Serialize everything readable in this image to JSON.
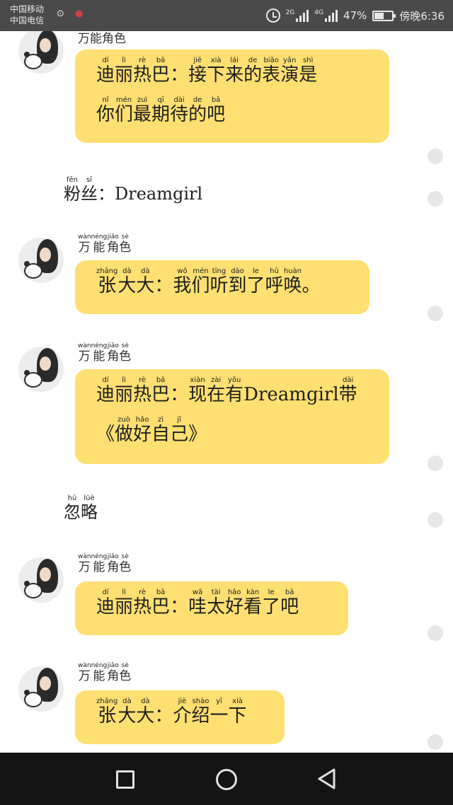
{
  "status_bar": {
    "carrier_1": "中国移动",
    "carrier_2": "中国电信",
    "network_1": "2G",
    "network_2": "4G",
    "battery": "47%",
    "battery_level": 0.47,
    "time": "傍晚6:36",
    "icons": [
      "alarm-icon",
      "signal-icon",
      "battery-icon"
    ]
  },
  "chat": {
    "messages": [
      {
        "sender": "万能角色",
        "pinyin_shown": false,
        "lines": [
          [
            [
              "迪",
              "dí"
            ],
            [
              "丽",
              "lì"
            ],
            [
              "热",
              "rè"
            ],
            [
              "巴",
              "bā"
            ],
            [
              "：",
              ""
            ],
            [
              "接",
              "jiē"
            ],
            [
              "下",
              "xià"
            ],
            [
              "来",
              "lái"
            ],
            [
              "的",
              "de"
            ],
            [
              "表",
              "biǎo"
            ],
            [
              "演",
              "yǎn"
            ],
            [
              "是",
              "shì"
            ]
          ],
          [
            [
              "你",
              "nǐ"
            ],
            [
              "们",
              "mén"
            ],
            [
              "最",
              "zuì"
            ],
            [
              "期",
              "qī"
            ],
            [
              "待",
              "dài"
            ],
            [
              "的",
              "de"
            ],
            [
              "吧",
              "bā"
            ]
          ]
        ]
      },
      {
        "plain": true,
        "lines": [
          [
            [
              "粉",
              "fěn"
            ],
            [
              "丝",
              "sī"
            ],
            [
              "：",
              ""
            ],
            [
              "Dreamgirl",
              ""
            ]
          ]
        ]
      },
      {
        "sender": "万能角色",
        "pinyin_shown": true,
        "sender_pinyin": [
          "wàn",
          "néng",
          "jiǎo",
          "sè"
        ],
        "lines": [
          [
            [
              "张",
              "zhāng"
            ],
            [
              "大",
              "dà"
            ],
            [
              "大",
              "dà"
            ],
            [
              "：",
              ""
            ],
            [
              "我",
              "wǒ"
            ],
            [
              "们",
              "mén"
            ],
            [
              "听",
              "tīng"
            ],
            [
              "到",
              "dào"
            ],
            [
              "了",
              "le"
            ],
            [
              "呼",
              "hū"
            ],
            [
              "唤",
              "huàn"
            ],
            [
              "。",
              ""
            ]
          ]
        ]
      },
      {
        "sender": "万能角色",
        "pinyin_shown": true,
        "sender_pinyin": [
          "wàn",
          "néng",
          "jiǎo",
          "sè"
        ],
        "lines": [
          [
            [
              "迪",
              "dí"
            ],
            [
              "丽",
              "lì"
            ],
            [
              "热",
              "rè"
            ],
            [
              "巴",
              "bā"
            ],
            [
              "：",
              ""
            ],
            [
              "现",
              "xiàn"
            ],
            [
              "在",
              "zài"
            ],
            [
              "有",
              "yǒu"
            ],
            [
              "Dreamgirl",
              ""
            ],
            [
              "带",
              "dài"
            ]
          ],
          [
            [
              "《",
              ""
            ],
            [
              "做",
              "zuò"
            ],
            [
              "好",
              "hǎo"
            ],
            [
              "自",
              "zì"
            ],
            [
              "己",
              "jǐ"
            ],
            [
              "》",
              ""
            ]
          ]
        ]
      },
      {
        "plain": true,
        "lines": [
          [
            [
              "忽",
              "hū"
            ],
            [
              "略",
              "lüè"
            ]
          ]
        ]
      },
      {
        "sender": "万能角色",
        "pinyin_shown": true,
        "sender_pinyin": [
          "wàn",
          "néng",
          "jiǎo",
          "sè"
        ],
        "lines": [
          [
            [
              "迪",
              "dí"
            ],
            [
              "丽",
              "lì"
            ],
            [
              "热",
              "rè"
            ],
            [
              "巴",
              "bā"
            ],
            [
              "：",
              ""
            ],
            [
              "哇",
              "wā"
            ],
            [
              "太",
              "tài"
            ],
            [
              "好",
              "hǎo"
            ],
            [
              "看",
              "kàn"
            ],
            [
              "了",
              "le"
            ],
            [
              "吧",
              "bā"
            ]
          ]
        ]
      },
      {
        "sender": "万能角色",
        "pinyin_shown": true,
        "sender_pinyin": [
          "wàn",
          "néng",
          "jiǎo",
          "sè"
        ],
        "lines": [
          [
            [
              "张",
              "zhāng"
            ],
            [
              "大",
              "dà"
            ],
            [
              "大",
              "dà"
            ],
            [
              "：",
              ""
            ],
            [
              "介",
              "jiè"
            ],
            [
              "绍",
              "shào"
            ],
            [
              "一",
              "yī"
            ],
            [
              "下",
              "xià"
            ]
          ]
        ]
      }
    ]
  },
  "nav_bar": {
    "icons": [
      "recent-apps-icon",
      "home-icon",
      "back-icon"
    ]
  }
}
